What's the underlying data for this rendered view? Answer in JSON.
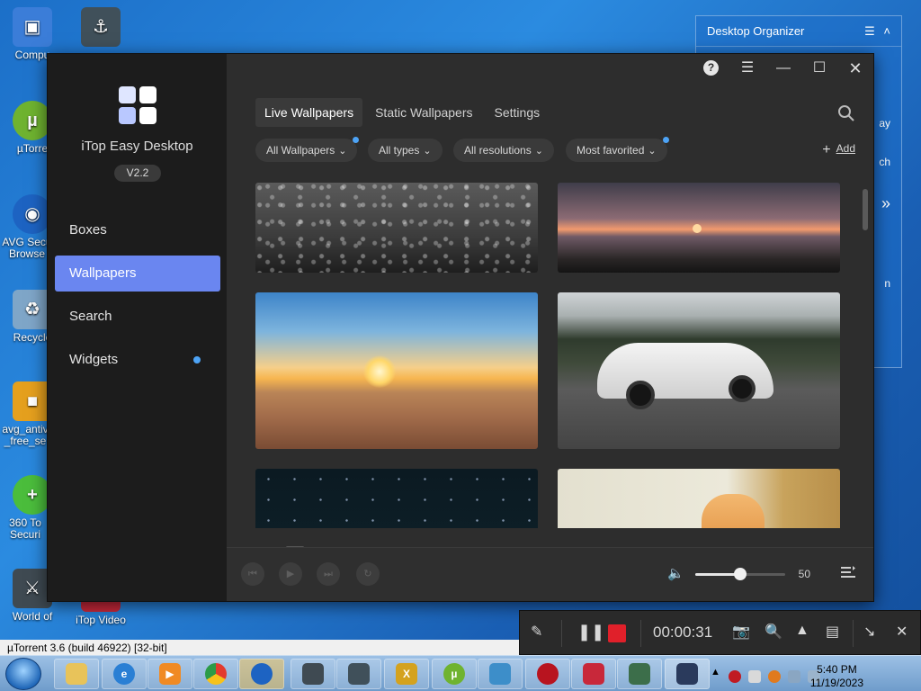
{
  "desktop": {
    "icons": [
      {
        "label": "Compu",
        "color": "#3b7dd8"
      },
      {
        "label": "",
        "color": "#40505a"
      },
      {
        "label": "µTorre",
        "color": "#6fb330"
      },
      {
        "label": "AVG Secu Browse",
        "color": "#1d63c2"
      },
      {
        "label": "Recycle",
        "color": "#7fa6c8"
      },
      {
        "label": "avg_antiv _free_se",
        "color": "#e5a01e"
      },
      {
        "label": "360 To Securi",
        "color": "#4bbd3c"
      },
      {
        "label": "World of",
        "color": "#3f4a52"
      },
      {
        "label": "iTop Video",
        "color": "#c8283a"
      }
    ],
    "organizer": {
      "title": "Desktop Organizer",
      "rows": [
        "ay",
        "ch",
        "»",
        "n"
      ]
    }
  },
  "app": {
    "name": "iTop Easy Desktop",
    "version": "V2.2",
    "nav": [
      {
        "label": "Boxes",
        "active": false
      },
      {
        "label": "Wallpapers",
        "active": true
      },
      {
        "label": "Search",
        "active": false
      },
      {
        "label": "Widgets",
        "active": false,
        "dot": true
      }
    ],
    "tabs": [
      {
        "label": "Live Wallpapers",
        "active": true
      },
      {
        "label": "Static Wallpapers",
        "active": false
      },
      {
        "label": "Settings",
        "active": false
      }
    ],
    "filters": [
      {
        "label": "All Wallpapers",
        "dot": true
      },
      {
        "label": "All types",
        "dot": false
      },
      {
        "label": "All resolutions",
        "dot": false
      },
      {
        "label": "Most favorited",
        "dot": true
      }
    ],
    "add_label": "Add",
    "wallpapers": [
      {
        "desc": "rain-drops"
      },
      {
        "desc": "birds-sunset"
      },
      {
        "desc": "desert-sunset"
      },
      {
        "desc": "white-sports-car"
      },
      {
        "desc": "night-stars"
      },
      {
        "desc": "kitten"
      }
    ],
    "player": {
      "volume": 50,
      "volume_label": "50"
    }
  },
  "recorder": {
    "time": "00:00:31"
  },
  "status_strip": "µTorrent 3.6  (build 46922) [32-bit]",
  "taskbar": {
    "clock_time": "5:40 PM",
    "clock_date": "11/19/2023"
  }
}
